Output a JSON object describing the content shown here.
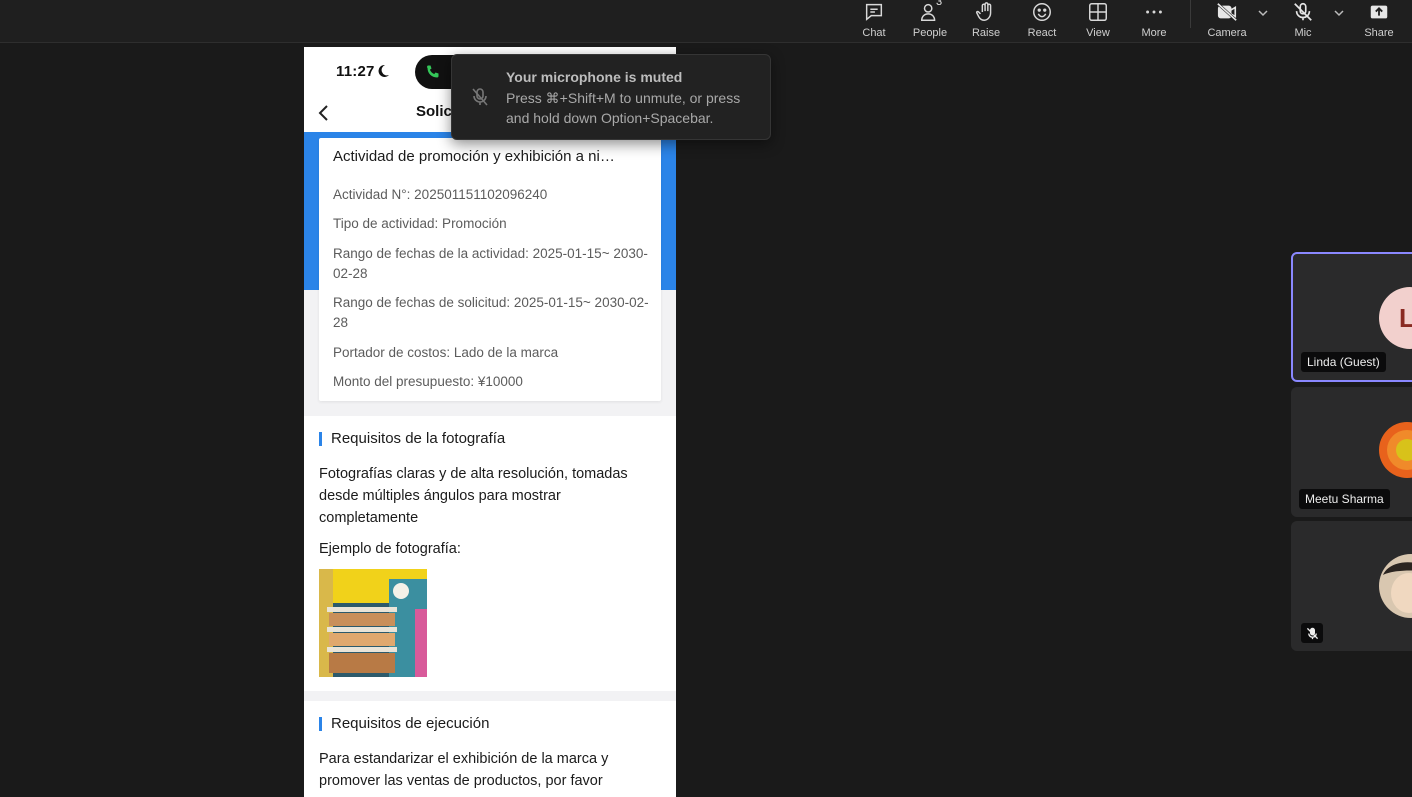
{
  "toolbar": {
    "chat_label": "Chat",
    "people_label": "People",
    "people_count": "3",
    "raise_label": "Raise",
    "react_label": "React",
    "view_label": "View",
    "more_label": "More",
    "camera_label": "Camera",
    "mic_label": "Mic",
    "share_label": "Share"
  },
  "toast": {
    "title": "Your microphone is muted",
    "message": "Press ⌘+Shift+M to unmute, or press and hold down Option+Spacebar."
  },
  "phone": {
    "status_time": "11:27",
    "nav_title": "Solic",
    "card": {
      "title": "Actividad de promoción y exhibición a ni…",
      "rows": [
        "Actividad N°: 202501151102096240",
        "Tipo de actividad:  Promoción",
        "Rango de fechas de la actividad: 2025-01-15~ 2030-02-28",
        "Rango de fechas de solicitud: 2025-01-15~ 2030-02-28",
        "Portador de costos: Lado de la marca",
        "Monto del presupuesto: ¥10000"
      ]
    },
    "photo_section": {
      "title": "Requisitos de la fotografía",
      "body": "Fotografías claras y de alta resolución, tomadas desde múltiples ángulos para mostrar completamente",
      "example_label": "Ejemplo de fotografía:"
    },
    "execution_section": {
      "title": "Requisitos de ejecución",
      "body": "Para estandarizar el exhibición de la marca y promover las ventas de productos, por favor"
    }
  },
  "participants": [
    {
      "name": "Linda (Guest)",
      "initial": "L",
      "active": true
    },
    {
      "name": "Meetu Sharma",
      "active": false
    },
    {
      "name": "",
      "muted": true,
      "active": false
    }
  ],
  "colors": {
    "accent_blue": "#2b84e8",
    "active_tile_border": "#8a88ff",
    "background": "#1a1a1a"
  }
}
